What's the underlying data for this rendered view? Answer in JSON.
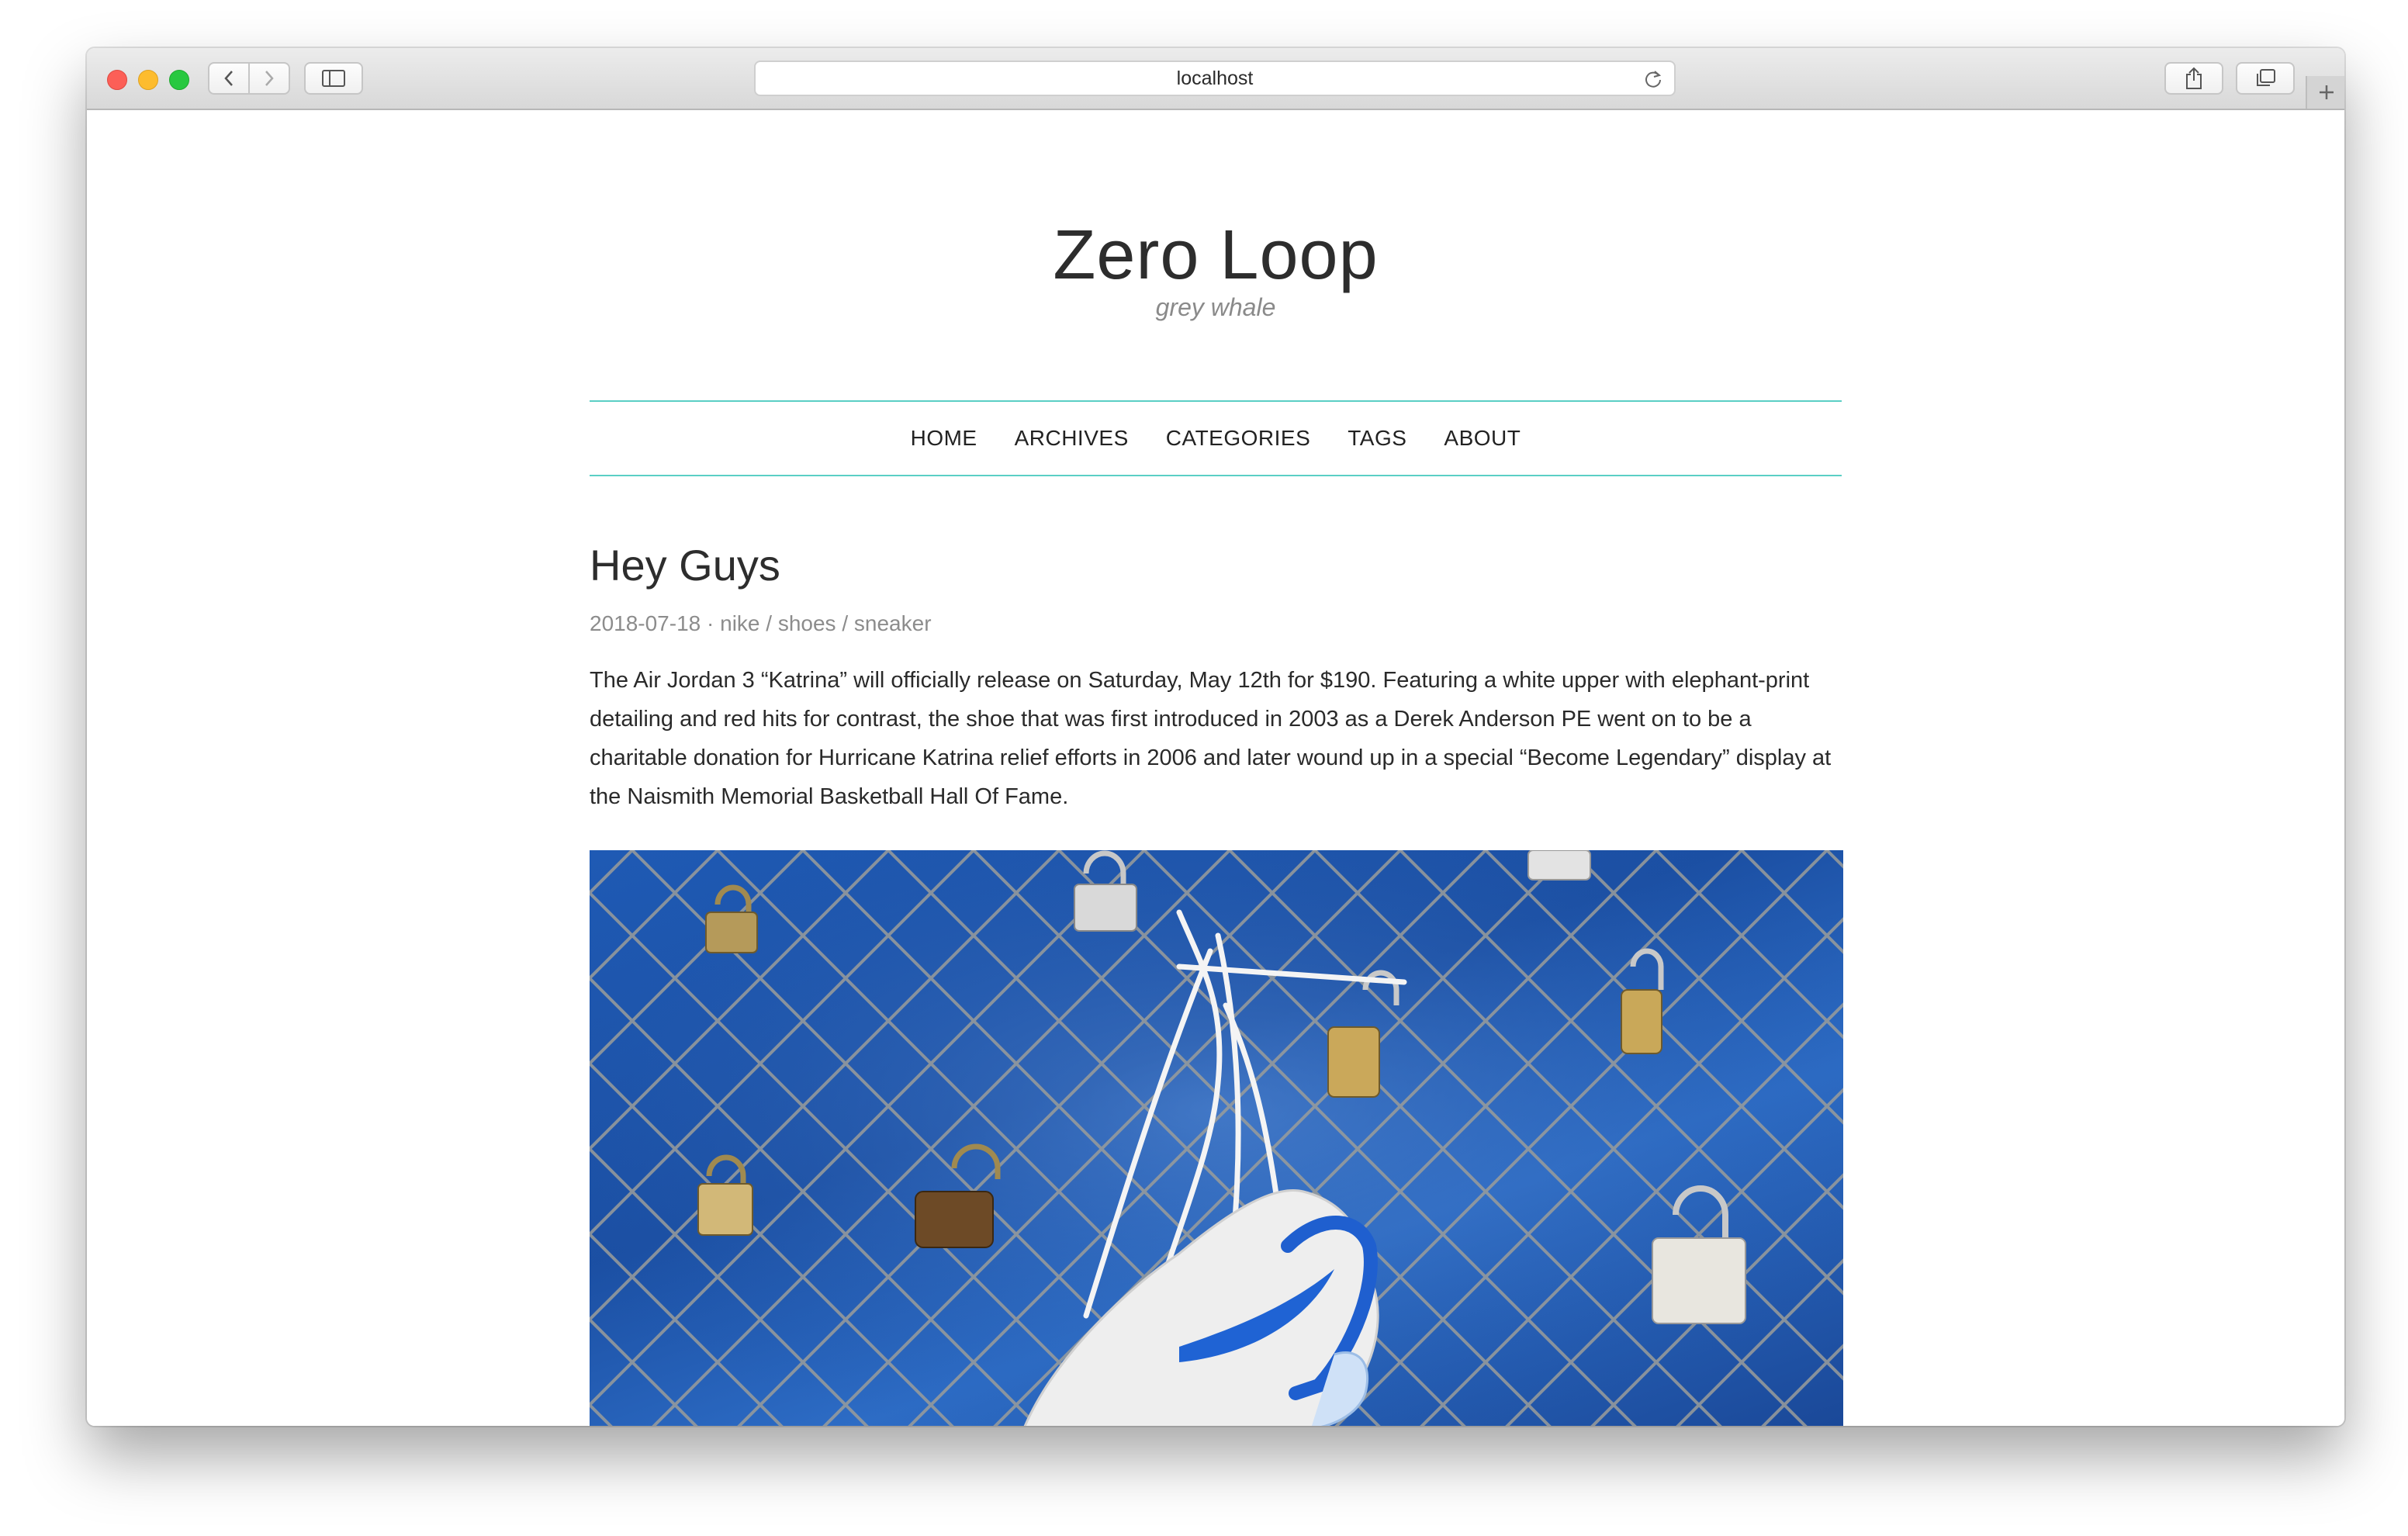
{
  "browser": {
    "address": "localhost"
  },
  "site": {
    "title": "Zero Loop",
    "subtitle": "grey whale"
  },
  "nav": {
    "items": [
      "HOME",
      "ARCHIVES",
      "CATEGORIES",
      "TAGS",
      "ABOUT"
    ]
  },
  "post": {
    "title": "Hey Guys",
    "date": "2018-07-18",
    "meta_separator": "·",
    "categories": [
      "nike",
      "shoes",
      "sneaker"
    ],
    "category_separator": "/",
    "body": "The Air Jordan 3 “Katrina” will officially release on Saturday, May 12th for $190. Featuring a white upper with elephant-print detailing and red hits for contrast, the shoe that was first introduced in 2003 as a Derek Anderson PE went on to be a charitable donation for Hurricane Katrina relief efforts in 2006 and later wound up in a special “Become Legendary” display at the Naismith Memorial Basketball Hall Of Fame.",
    "image": {
      "description_icon": "photo-sneaker-on-fence",
      "accent": "#1f5ab4"
    }
  },
  "colors": {
    "nav_rule": "#5bcfc5",
    "text": "#2d2d2d",
    "muted": "#8c8c8c"
  }
}
